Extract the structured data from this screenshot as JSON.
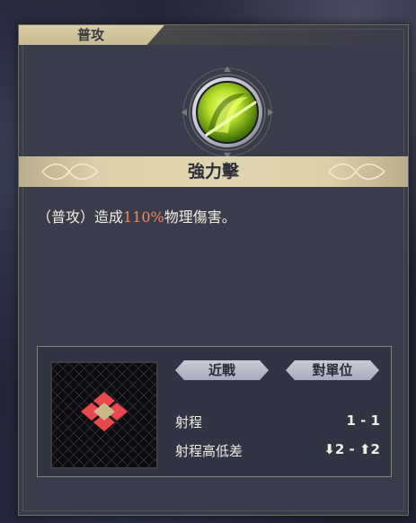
{
  "panel": {
    "category_tab": "普攻",
    "skill_name": "強力擊",
    "description": {
      "prefix": "（普攻）造成",
      "highlight": "110%",
      "suffix": "物理傷害。"
    },
    "icon": "green-slash-skill-icon"
  },
  "attack_info": {
    "type_tag": "近戰",
    "target_tag": "對單位",
    "rows": [
      {
        "label": "射程",
        "value": "1 - 1"
      },
      {
        "label": "射程高低差",
        "value": "⬇2 - ⬆2"
      }
    ]
  },
  "colors": {
    "highlight": "#f08a63",
    "tab": "#d8cda7",
    "panel": "#3a3c4b",
    "range_cell": "#e8474f",
    "origin_cell": "#c9b88a"
  }
}
